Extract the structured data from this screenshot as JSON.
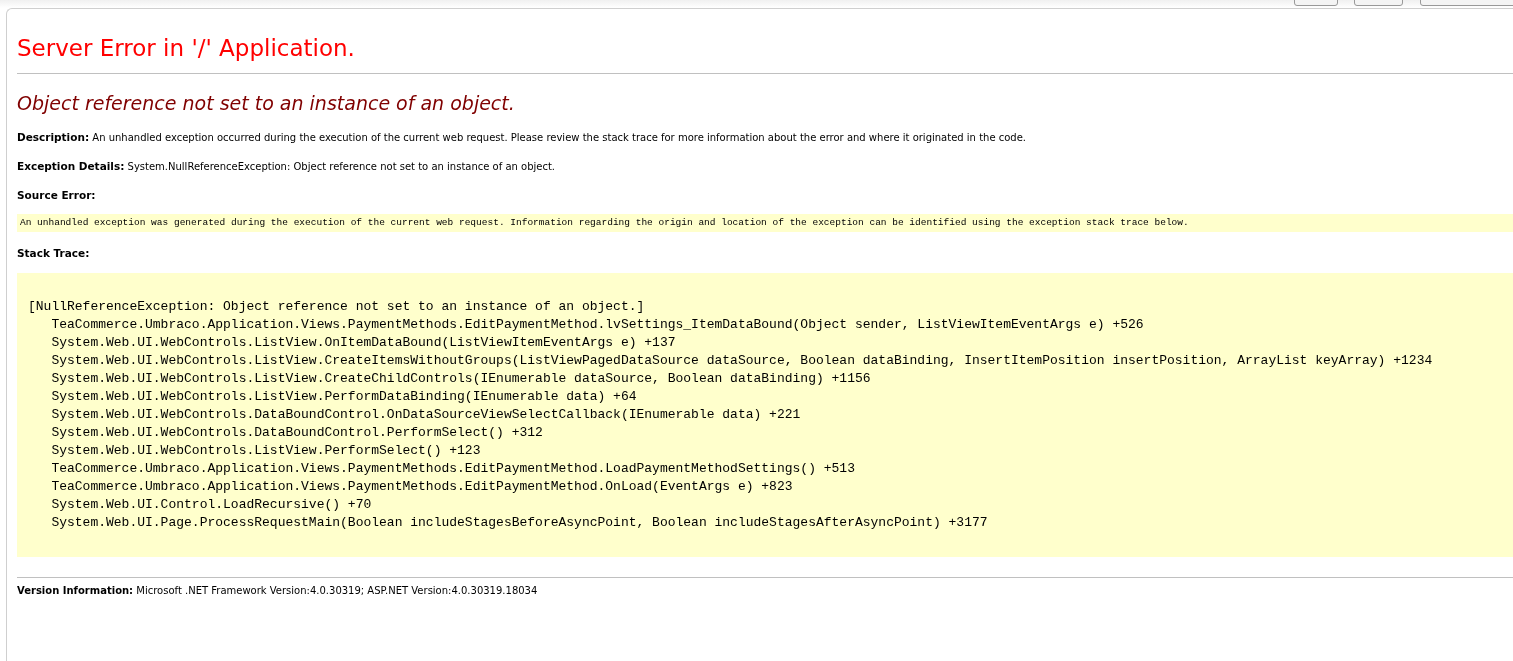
{
  "title": "Server Error in '/' Application.",
  "message": "Object reference not set to an instance of an object.",
  "details": [
    {
      "kind": "text",
      "text": "**Description:** An unhandled exception occurred during the execution of the current web request. Please review the stack trace for more information about the error and where it originated in the code."
    },
    {
      "kind": "text",
      "text": "**Exception Details:** System.NullReferenceException: Object reference not set to an instance of an object."
    },
    {
      "kind": "heading",
      "text": "Source Error:"
    },
    {
      "kind": "code",
      "text": "An unhandled exception was generated during the execution of the current web request. Information regarding the origin and location of the exception can be identified using the exception stack trace below."
    },
    {
      "kind": "heading",
      "text": "Stack Trace:"
    }
  ],
  "stack_trace": [
    "[NullReferenceException: Object reference not set to an instance of an object.]",
    "   TeaCommerce.Umbraco.Application.Views.PaymentMethods.EditPaymentMethod.lvSettings_ItemDataBound(Object sender, ListViewItemEventArgs e) +526",
    "   System.Web.UI.WebControls.ListView.OnItemDataBound(ListViewItemEventArgs e) +137",
    "   System.Web.UI.WebControls.ListView.CreateItemsWithoutGroups(ListViewPagedDataSource dataSource, Boolean dataBinding, InsertItemPosition insertPosition, ArrayList keyArray) +1234",
    "   System.Web.UI.WebControls.ListView.CreateChildControls(IEnumerable dataSource, Boolean dataBinding) +1156",
    "   System.Web.UI.WebControls.ListView.PerformDataBinding(IEnumerable data) +64",
    "   System.Web.UI.WebControls.DataBoundControl.OnDataSourceViewSelectCallback(IEnumerable data) +221",
    "   System.Web.UI.WebControls.DataBoundControl.PerformSelect() +312",
    "   System.Web.UI.WebControls.ListView.PerformSelect() +123",
    "   TeaCommerce.Umbraco.Application.Views.PaymentMethods.EditPaymentMethod.LoadPaymentMethodSettings() +513",
    "   TeaCommerce.Umbraco.Application.Views.PaymentMethods.EditPaymentMethod.OnLoad(EventArgs e) +823",
    "   System.Web.UI.Control.LoadRecursive() +70",
    "   System.Web.UI.Page.ProcessRequestMain(Boolean includeStagesBeforeAsyncPoint, Boolean includeStagesAfterAsyncPoint) +3177"
  ],
  "version": "**Version Information:** Microsoft .NET Framework Version:4.0.30319; ASP.NET Version:4.0.30319.18034"
}
